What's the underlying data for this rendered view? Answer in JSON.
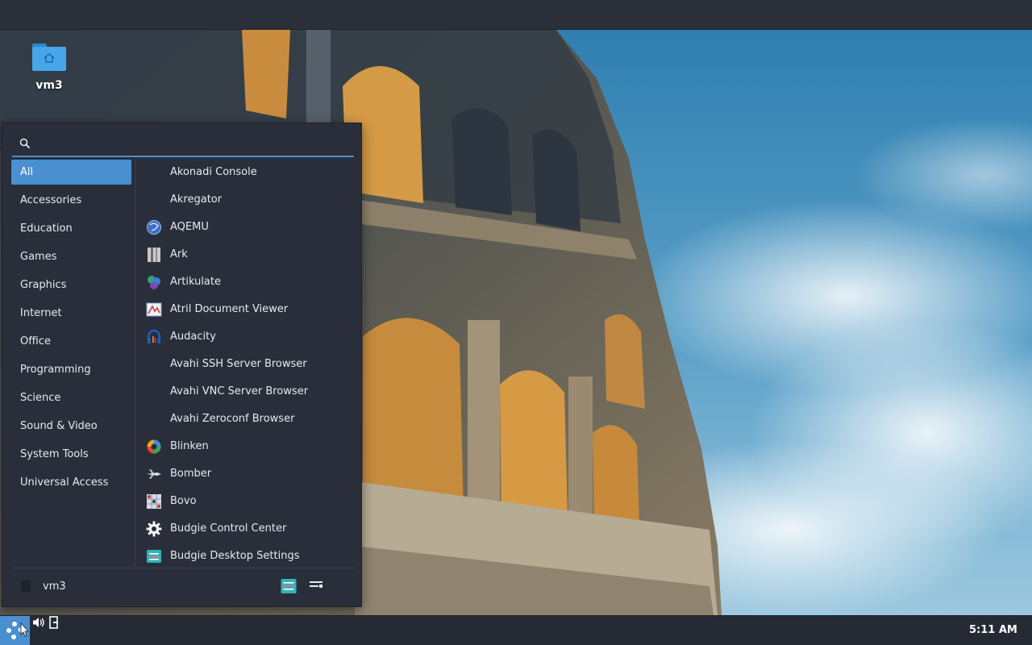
{
  "desktop": {
    "icon_label": "vm3"
  },
  "menu": {
    "search": {
      "value": "",
      "placeholder": ""
    },
    "categories": [
      {
        "label": "All",
        "active": true
      },
      {
        "label": "Accessories"
      },
      {
        "label": "Education"
      },
      {
        "label": "Games"
      },
      {
        "label": "Graphics"
      },
      {
        "label": "Internet"
      },
      {
        "label": "Office"
      },
      {
        "label": "Programming"
      },
      {
        "label": "Science"
      },
      {
        "label": "Sound & Video"
      },
      {
        "label": "System Tools"
      },
      {
        "label": "Universal Access"
      }
    ],
    "apps": [
      {
        "label": "Akonadi Console",
        "icon": "blank-icon"
      },
      {
        "label": "Akregator",
        "icon": "blank-icon"
      },
      {
        "label": "AQEMU",
        "icon": "aqemu-icon"
      },
      {
        "label": "Ark",
        "icon": "ark-icon"
      },
      {
        "label": "Artikulate",
        "icon": "artikulate-icon"
      },
      {
        "label": "Atril Document Viewer",
        "icon": "atril-icon"
      },
      {
        "label": "Audacity",
        "icon": "audacity-icon"
      },
      {
        "label": "Avahi SSH Server Browser",
        "icon": "blank-icon"
      },
      {
        "label": "Avahi VNC Server Browser",
        "icon": "blank-icon"
      },
      {
        "label": "Avahi Zeroconf Browser",
        "icon": "blank-icon"
      },
      {
        "label": "Blinken",
        "icon": "blinken-icon"
      },
      {
        "label": "Bomber",
        "icon": "bomber-icon"
      },
      {
        "label": "Bovo",
        "icon": "bovo-icon"
      },
      {
        "label": "Budgie Control Center",
        "icon": "gear-icon"
      },
      {
        "label": "Budgie Desktop Settings",
        "icon": "budgie-settings-icon"
      }
    ],
    "footer": {
      "user_name": "vm3"
    }
  },
  "panel": {
    "clock": "5:11 AM"
  },
  "colors": {
    "accent": "#4a8fcf",
    "menu_bg": "#2a2e3a",
    "panel_bg": "#262a34"
  }
}
